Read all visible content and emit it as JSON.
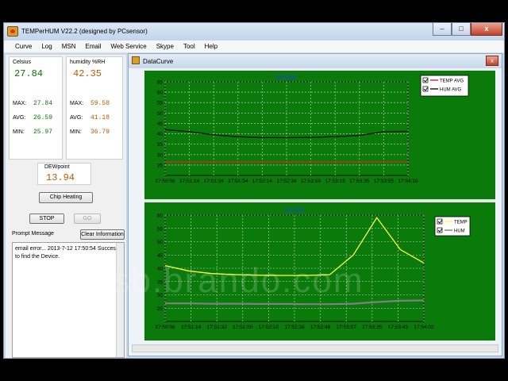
{
  "window": {
    "title": "TEMPerHUM V22.2 (designed by PCsensor)",
    "buttons": [
      "–",
      "□",
      "x"
    ]
  },
  "menu": [
    "Curve",
    "Log",
    "MSN",
    "Email",
    "Web Service",
    "Skype",
    "Tool",
    "Help"
  ],
  "celsius": {
    "label": "Celsius",
    "value": "27.84",
    "max_label": "MAX:",
    "max": "27.84",
    "avg_label": "AVG:",
    "avg": "26.59",
    "min_label": "MIN:",
    "min": "25.97"
  },
  "humidity": {
    "label": "humidity %RH",
    "value": "42.35",
    "max_label": "MAX:",
    "max": "59.58",
    "avg_label": "AVG:",
    "avg": "41.18",
    "min_label": "MIN:",
    "min": "36.79"
  },
  "dew": {
    "label": "DEWpoint",
    "value": "13.94"
  },
  "buttons": {
    "chip_heating": "Chip Heating",
    "stop": "STOP",
    "go": "GO",
    "clear": "Clear Information"
  },
  "prompt": {
    "label": "Prompt Message",
    "text": "email error... 2013-7-12 17:50:54 Success to find the Device."
  },
  "child": {
    "title": "DataCurve",
    "close": "x"
  },
  "colors": {
    "plot_bg": "#0a7a0a",
    "temp": "#e02020",
    "hum": "#111111",
    "rt_temp": "#ffff40",
    "rt_hum": "#808080"
  },
  "watermark": "usb.brando.com",
  "chart_data": [
    {
      "type": "line",
      "title": "average",
      "ylim": [
        20,
        65
      ],
      "yticks": [
        25,
        30,
        35,
        40,
        45,
        50,
        55,
        60,
        65
      ],
      "categories": [
        "17:50:56",
        "17:51:14",
        "17:51:34",
        "17:51:54",
        "17:52:14",
        "17:52:34",
        "17:52:55",
        "17:53:15",
        "17:53:35",
        "17:53:55",
        "17:54:15"
      ],
      "series": [
        {
          "name": "TEMP AVG",
          "values": [
            26.4,
            26.4,
            26.4,
            26.4,
            26.4,
            26.4,
            26.4,
            26.4,
            26.4,
            26.5,
            26.6
          ]
        },
        {
          "name": "HUM AVG",
          "values": [
            42.0,
            41.0,
            39.5,
            38.6,
            38.2,
            38.1,
            38.3,
            38.6,
            39.2,
            41.0,
            41.2
          ]
        }
      ],
      "grid": true,
      "legend": "top-right"
    },
    {
      "type": "line",
      "title": "real time",
      "ylim": [
        20,
        60
      ],
      "yticks": [
        25,
        30,
        35,
        40,
        45,
        50,
        55,
        60
      ],
      "categories": [
        "17:50:56",
        "17:51:14",
        "17:51:32",
        "17:51:50",
        "17:52:10",
        "17:52:28",
        "17:52:46",
        "17:53:07",
        "17:53:25",
        "17:53:43",
        "17:54:03"
      ],
      "series": [
        {
          "name": "TEMP",
          "values": [
            41.0,
            39.0,
            38.0,
            37.6,
            37.4,
            37.3,
            37.3,
            37.6,
            45.0,
            59.0,
            47.0,
            42.0
          ]
        },
        {
          "name": "HUM",
          "values": [
            26.8,
            26.8,
            26.7,
            26.7,
            26.6,
            26.6,
            26.5,
            26.5,
            26.7,
            27.3,
            27.8,
            27.9
          ]
        }
      ],
      "grid": true,
      "legend": "top-right"
    }
  ]
}
